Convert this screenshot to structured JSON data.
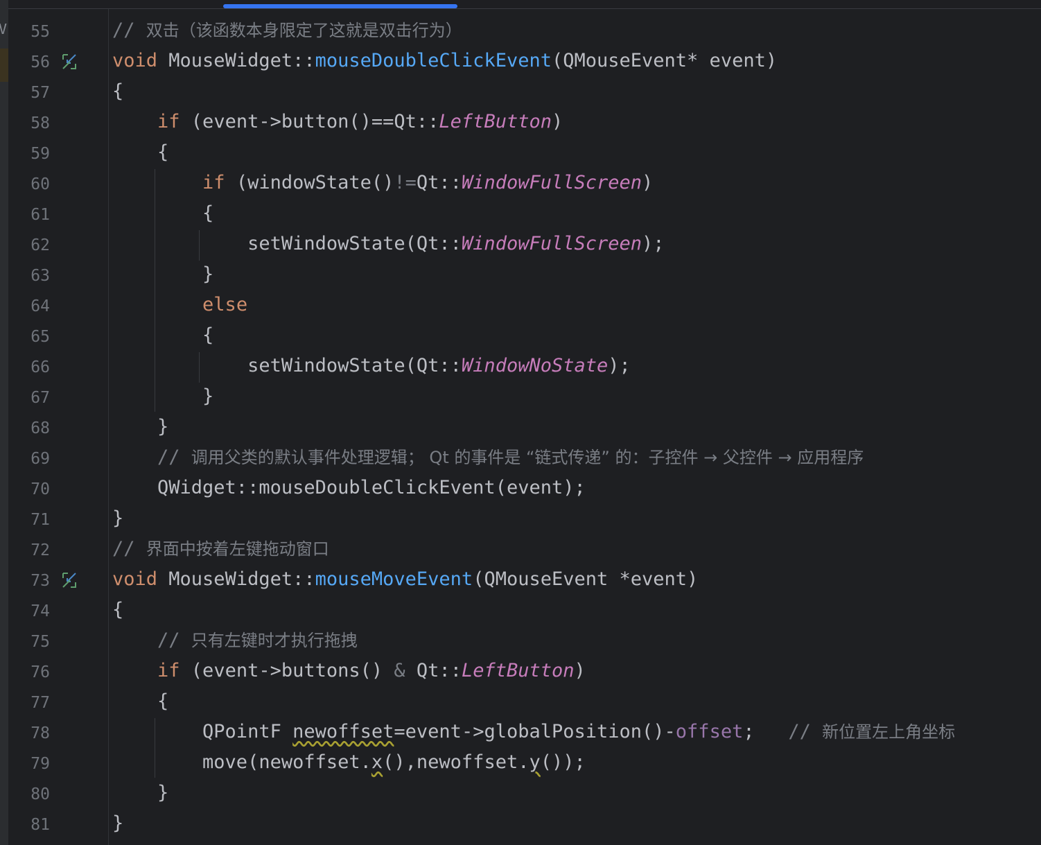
{
  "editor": {
    "accent": "#3574f0",
    "background": "#1e1f22",
    "gutter_mark": "V"
  },
  "lines": [
    {
      "n": "55",
      "tokens": [
        {
          "t": "// ",
          "c": "cm"
        },
        {
          "t": "双击（该函数本身限定了这就是双击行为）",
          "c": "cmz"
        }
      ]
    },
    {
      "n": "56",
      "icon": "implements-icon",
      "tokens": [
        {
          "t": "void",
          "c": "kw"
        },
        {
          "t": " MouseWidget::",
          "c": ""
        },
        {
          "t": "mouseDoubleClickEvent",
          "c": "fn"
        },
        {
          "t": "(QMouseEvent* event)",
          "c": ""
        }
      ]
    },
    {
      "n": "57",
      "tokens": [
        {
          "t": "{",
          "c": ""
        }
      ]
    },
    {
      "n": "58",
      "tokens": [
        {
          "t": "    ",
          "c": ""
        },
        {
          "t": "if",
          "c": "kw"
        },
        {
          "t": " (event->button()==Qt::",
          "c": ""
        },
        {
          "t": "LeftButton",
          "c": "en"
        },
        {
          "t": ")",
          "c": ""
        }
      ]
    },
    {
      "n": "59",
      "tokens": [
        {
          "t": "    {",
          "c": ""
        }
      ]
    },
    {
      "n": "60",
      "tokens": [
        {
          "t": "        ",
          "c": ""
        },
        {
          "t": "if",
          "c": "kw"
        },
        {
          "t": " (windowState()",
          "c": ""
        },
        {
          "t": "!=",
          "c": "cm"
        },
        {
          "t": "Qt::",
          "c": ""
        },
        {
          "t": "WindowFullScreen",
          "c": "en"
        },
        {
          "t": ")",
          "c": ""
        }
      ]
    },
    {
      "n": "61",
      "tokens": [
        {
          "t": "        {",
          "c": ""
        }
      ]
    },
    {
      "n": "62",
      "tokens": [
        {
          "t": "            setWindowState(Qt::",
          "c": ""
        },
        {
          "t": "WindowFullScreen",
          "c": "en"
        },
        {
          "t": ");",
          "c": ""
        }
      ]
    },
    {
      "n": "63",
      "tokens": [
        {
          "t": "        }",
          "c": ""
        }
      ]
    },
    {
      "n": "64",
      "tokens": [
        {
          "t": "        ",
          "c": ""
        },
        {
          "t": "else",
          "c": "kw"
        }
      ]
    },
    {
      "n": "65",
      "tokens": [
        {
          "t": "        {",
          "c": ""
        }
      ]
    },
    {
      "n": "66",
      "tokens": [
        {
          "t": "            setWindowState(Qt::",
          "c": ""
        },
        {
          "t": "WindowNoState",
          "c": "en"
        },
        {
          "t": ");",
          "c": ""
        }
      ]
    },
    {
      "n": "67",
      "tokens": [
        {
          "t": "        }",
          "c": ""
        }
      ]
    },
    {
      "n": "68",
      "tokens": [
        {
          "t": "    }",
          "c": ""
        }
      ]
    },
    {
      "n": "69",
      "tokens": [
        {
          "t": "    // ",
          "c": "cm"
        },
        {
          "t": "调用父类的默认事件处理逻辑； Qt 的事件是 “链式传递” 的：子控件 → 父控件 → 应用程序",
          "c": "cmz"
        }
      ]
    },
    {
      "n": "70",
      "tokens": [
        {
          "t": "    QWidget::mouseDoubleClickEvent(event);",
          "c": ""
        }
      ]
    },
    {
      "n": "71",
      "tokens": [
        {
          "t": "}",
          "c": ""
        }
      ]
    },
    {
      "n": "72",
      "tokens": [
        {
          "t": "// ",
          "c": "cm"
        },
        {
          "t": "界面中按着左键拖动窗口",
          "c": "cmz"
        }
      ]
    },
    {
      "n": "73",
      "icon": "implements-icon",
      "tokens": [
        {
          "t": "void",
          "c": "kw"
        },
        {
          "t": " MouseWidget::",
          "c": ""
        },
        {
          "t": "mouseMoveEvent",
          "c": "fn"
        },
        {
          "t": "(QMouseEvent *event)",
          "c": ""
        }
      ]
    },
    {
      "n": "74",
      "tokens": [
        {
          "t": "{",
          "c": ""
        }
      ]
    },
    {
      "n": "75",
      "tokens": [
        {
          "t": "    // ",
          "c": "cm"
        },
        {
          "t": "只有左键时才执行拖拽",
          "c": "cmz"
        }
      ]
    },
    {
      "n": "76",
      "tokens": [
        {
          "t": "    ",
          "c": ""
        },
        {
          "t": "if",
          "c": "kw"
        },
        {
          "t": " (event->buttons() ",
          "c": ""
        },
        {
          "t": "&",
          "c": "cm"
        },
        {
          "t": " Qt::",
          "c": ""
        },
        {
          "t": "LeftButton",
          "c": "en"
        },
        {
          "t": ")",
          "c": ""
        }
      ]
    },
    {
      "n": "77",
      "tokens": [
        {
          "t": "    {",
          "c": ""
        }
      ]
    },
    {
      "n": "78",
      "tokens": [
        {
          "t": "        QPointF ",
          "c": ""
        },
        {
          "t": "newoffset",
          "c": "uw"
        },
        {
          "t": "=event->globalPosition()-",
          "c": ""
        },
        {
          "t": "offset",
          "c": "mem"
        },
        {
          "t": ";   ",
          "c": ""
        },
        {
          "t": "// ",
          "c": "cm"
        },
        {
          "t": "新位置左上角坐标",
          "c": "cmz"
        }
      ]
    },
    {
      "n": "79",
      "tokens": [
        {
          "t": "        move(newoffset.",
          "c": ""
        },
        {
          "t": "x",
          "c": "uw"
        },
        {
          "t": "(),newoffset.",
          "c": ""
        },
        {
          "t": "y",
          "c": "uw"
        },
        {
          "t": "());",
          "c": ""
        }
      ]
    },
    {
      "n": "80",
      "tokens": [
        {
          "t": "    }",
          "c": ""
        }
      ]
    },
    {
      "n": "81",
      "tokens": [
        {
          "t": "}",
          "c": ""
        }
      ]
    }
  ]
}
